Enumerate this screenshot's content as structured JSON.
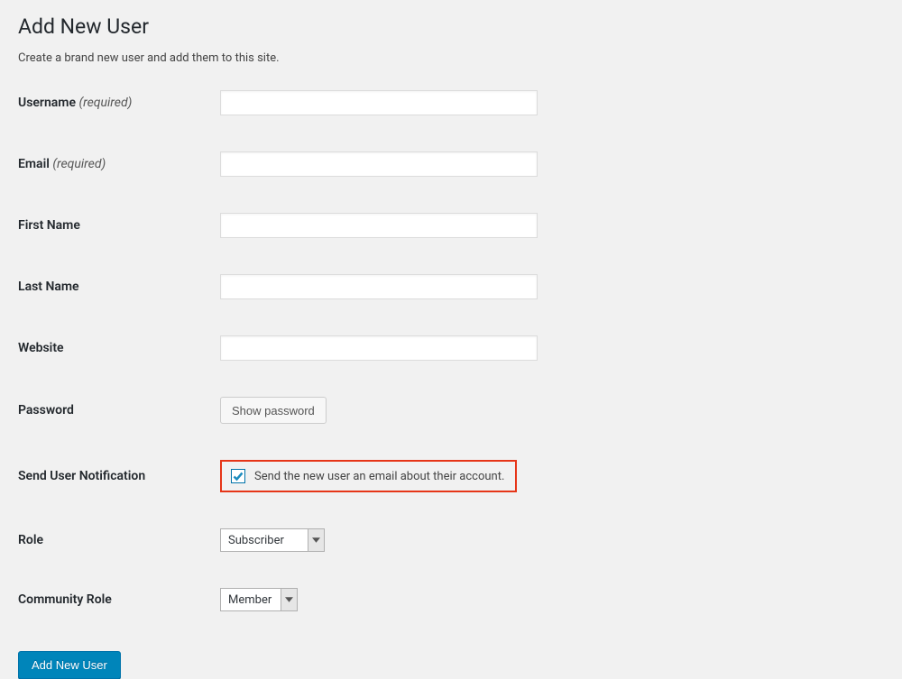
{
  "page": {
    "title": "Add New User",
    "description": "Create a brand new user and add them to this site."
  },
  "fields": {
    "username": {
      "label": "Username",
      "required_text": "(required)",
      "value": ""
    },
    "email": {
      "label": "Email",
      "required_text": "(required)",
      "value": ""
    },
    "first_name": {
      "label": "First Name",
      "value": ""
    },
    "last_name": {
      "label": "Last Name",
      "value": ""
    },
    "website": {
      "label": "Website",
      "value": ""
    },
    "password": {
      "label": "Password",
      "show_button": "Show password"
    },
    "notification": {
      "label": "Send User Notification",
      "checkbox_label": "Send the new user an email about their account.",
      "checked": true
    },
    "role": {
      "label": "Role",
      "selected": "Subscriber"
    },
    "community_role": {
      "label": "Community Role",
      "selected": "Member"
    }
  },
  "submit": {
    "label": "Add New User"
  }
}
